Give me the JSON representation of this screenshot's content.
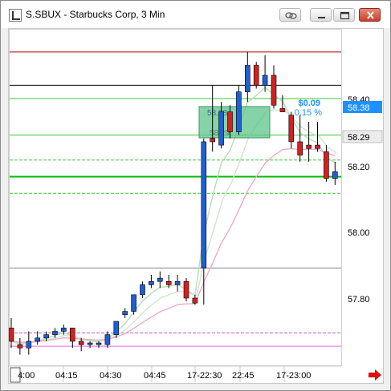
{
  "window": {
    "title": "S.SBUX - Starbucks Corp, 3 Min",
    "buttons": [
      "link",
      "minimize",
      "maximize",
      "close"
    ]
  },
  "price_axis": {
    "ticks": [
      "58.40",
      "58.20",
      "58.00",
      "57.80"
    ],
    "current_price_label": "58.38",
    "second_price_label": "58.29"
  },
  "time_axis": {
    "labels": [
      "4:00",
      "04:15",
      "04:30",
      "04:45",
      "17-22:30",
      "22:45",
      "17-23:00"
    ]
  },
  "position_box": {
    "entry_label": "58.38",
    "stop_label": "58.29",
    "pl_value": "$0.09",
    "pl_percent": "0.15 %"
  },
  "colors": {
    "up_candle": "#1f5fd6",
    "down_candle": "#d42020",
    "profit_text": "#1e90ff",
    "position_fill": "#5ec48a",
    "green_line": "#33cc33",
    "arrow": "#e01010"
  },
  "chart_data": {
    "type": "candlestick",
    "title": "S.SBUX - Starbucks Corp, 3 Min",
    "ylim": [
      57.63,
      58.55
    ],
    "x_labels": [
      "4:00",
      "04:15",
      "04:30",
      "04:45",
      "17-22:30",
      "22:45",
      "17-23:00"
    ],
    "candles": [
      {
        "o": 57.71,
        "h": 57.74,
        "l": 57.65,
        "c": 57.67
      },
      {
        "o": 57.66,
        "h": 57.68,
        "l": 57.63,
        "c": 57.65
      },
      {
        "o": 57.65,
        "h": 57.7,
        "l": 57.63,
        "c": 57.67
      },
      {
        "o": 57.67,
        "h": 57.7,
        "l": 57.66,
        "c": 57.68
      },
      {
        "o": 57.68,
        "h": 57.7,
        "l": 57.67,
        "c": 57.69
      },
      {
        "o": 57.69,
        "h": 57.71,
        "l": 57.68,
        "c": 57.7
      },
      {
        "o": 57.7,
        "h": 57.72,
        "l": 57.69,
        "c": 57.71
      },
      {
        "o": 57.71,
        "h": 57.71,
        "l": 57.65,
        "c": 57.67
      },
      {
        "o": 57.67,
        "h": 57.68,
        "l": 57.64,
        "c": 57.66
      },
      {
        "o": 57.66,
        "h": 57.67,
        "l": 57.65,
        "c": 57.665
      },
      {
        "o": 57.66,
        "h": 57.67,
        "l": 57.65,
        "c": 57.665
      },
      {
        "o": 57.66,
        "h": 57.7,
        "l": 57.65,
        "c": 57.69
      },
      {
        "o": 57.69,
        "h": 57.73,
        "l": 57.68,
        "c": 57.73
      },
      {
        "o": 57.75,
        "h": 57.77,
        "l": 57.74,
        "c": 57.76
      },
      {
        "o": 57.76,
        "h": 57.81,
        "l": 57.75,
        "c": 57.81
      },
      {
        "o": 57.81,
        "h": 57.85,
        "l": 57.8,
        "c": 57.84
      },
      {
        "o": 57.84,
        "h": 57.87,
        "l": 57.83,
        "c": 57.85
      },
      {
        "o": 57.85,
        "h": 57.88,
        "l": 57.83,
        "c": 57.86
      },
      {
        "o": 57.85,
        "h": 57.87,
        "l": 57.83,
        "c": 57.84
      },
      {
        "o": 57.84,
        "h": 57.87,
        "l": 57.82,
        "c": 57.85
      },
      {
        "o": 57.85,
        "h": 57.86,
        "l": 57.79,
        "c": 57.8
      },
      {
        "o": 57.8,
        "h": 57.81,
        "l": 57.78,
        "c": 57.785
      },
      {
        "o": 57.89,
        "h": 58.28,
        "l": 57.78,
        "c": 58.27
      },
      {
        "o": 58.28,
        "h": 58.44,
        "l": 58.24,
        "c": 58.27
      },
      {
        "o": 58.26,
        "h": 58.39,
        "l": 58.25,
        "c": 58.36
      },
      {
        "o": 58.36,
        "h": 58.38,
        "l": 58.28,
        "c": 58.3
      },
      {
        "o": 58.3,
        "h": 58.44,
        "l": 58.29,
        "c": 58.42
      },
      {
        "o": 58.42,
        "h": 58.54,
        "l": 58.39,
        "c": 58.5
      },
      {
        "o": 58.5,
        "h": 58.51,
        "l": 58.43,
        "c": 58.44
      },
      {
        "o": 58.44,
        "h": 58.53,
        "l": 58.42,
        "c": 58.47
      },
      {
        "o": 58.47,
        "h": 58.5,
        "l": 58.37,
        "c": 58.38
      },
      {
        "o": 58.37,
        "h": 58.41,
        "l": 58.36,
        "c": 58.36
      },
      {
        "o": 58.35,
        "h": 58.36,
        "l": 58.25,
        "c": 58.27
      },
      {
        "o": 58.27,
        "h": 58.35,
        "l": 58.21,
        "c": 58.23
      },
      {
        "o": 58.26,
        "h": 58.33,
        "l": 58.21,
        "c": 58.25
      },
      {
        "o": 58.26,
        "h": 58.33,
        "l": 58.24,
        "c": 58.25
      },
      {
        "o": 58.24,
        "h": 58.26,
        "l": 58.15,
        "c": 58.16
      },
      {
        "o": 58.16,
        "h": 58.21,
        "l": 58.14,
        "c": 58.18
      }
    ],
    "horizontal_levels": [
      {
        "price": 58.54,
        "color": "#b00000",
        "style": "solid"
      },
      {
        "price": 58.44,
        "color": "#000000",
        "style": "solid"
      },
      {
        "price": 58.4,
        "color": "#33cc33",
        "style": "solid"
      },
      {
        "price": 58.29,
        "color": "#33cc33",
        "style": "solid"
      },
      {
        "price": 58.215,
        "color": "#33cc33",
        "style": "dashed"
      },
      {
        "price": 58.165,
        "color": "#00bb00",
        "style": "solid-bold"
      },
      {
        "price": 58.115,
        "color": "#33cc33",
        "style": "dashed"
      },
      {
        "price": 57.89,
        "color": "#808080",
        "style": "solid"
      },
      {
        "price": 57.695,
        "color": "#cc55cc",
        "style": "dashed"
      },
      {
        "price": 57.655,
        "color": "#ee66ee",
        "style": "solid"
      }
    ]
  }
}
